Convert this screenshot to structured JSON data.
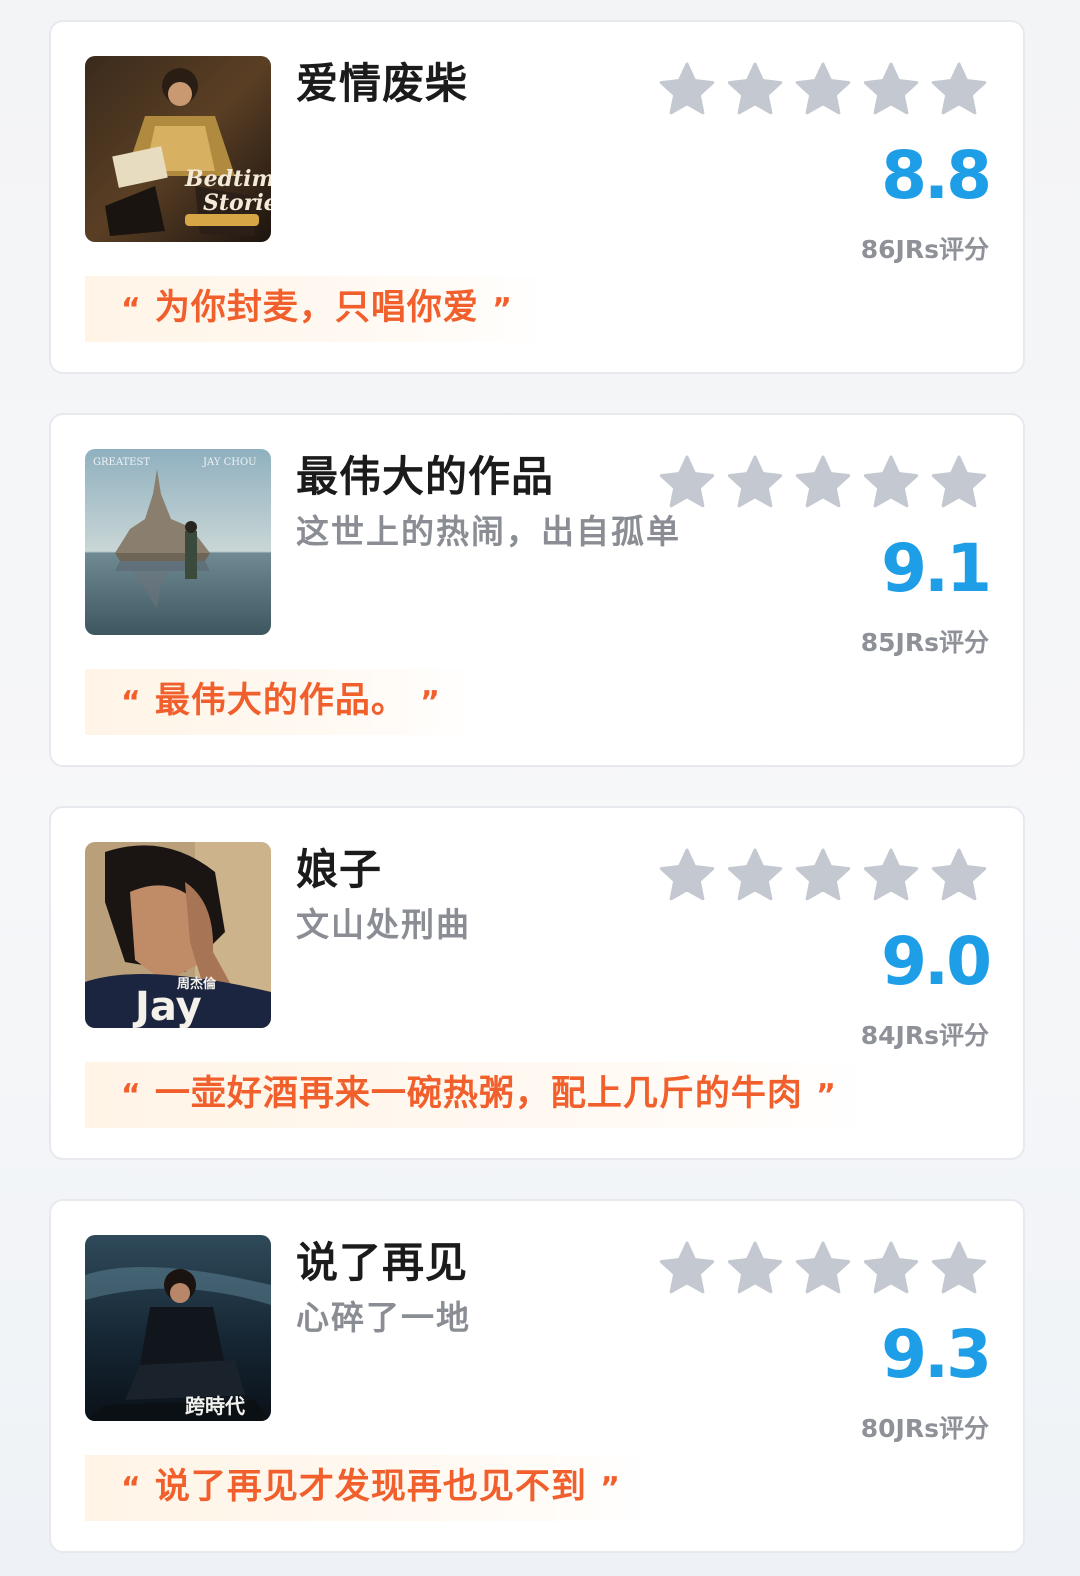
{
  "colors": {
    "score": "#1f9ee8",
    "quote_text": "#f15f2c",
    "quote_bg": "#fff4e6",
    "star": "#c4c8d0",
    "title": "#1b1b1b",
    "subtitle": "#8a8d93"
  },
  "quote_open": "“",
  "quote_close": "”",
  "songs": [
    {
      "title": "爱情废柴",
      "subtitle": "",
      "score": "8.8",
      "votes": "86JRs评分",
      "stars_filled": 0,
      "stars_total": 5,
      "quote": "为你封麦，只唱你爱",
      "cover_icon": "album-cover-bedtime-stories"
    },
    {
      "title": "最伟大的作品",
      "subtitle": "这世上的热闹，出自孤单",
      "score": "9.1",
      "votes": "85JRs评分",
      "stars_filled": 0,
      "stars_total": 5,
      "quote": "最伟大的作品。",
      "cover_icon": "album-cover-greatest-works"
    },
    {
      "title": "娘子",
      "subtitle": "文山处刑曲",
      "score": "9.0",
      "votes": "84JRs评分",
      "stars_filled": 0,
      "stars_total": 5,
      "quote": "一壶好酒再来一碗热粥，配上几斤的牛肉",
      "cover_icon": "album-cover-jay"
    },
    {
      "title": "说了再见",
      "subtitle": "心碎了一地",
      "score": "9.3",
      "votes": "80JRs评分",
      "stars_filled": 0,
      "stars_total": 5,
      "quote": "说了再见才发现再也见不到",
      "cover_icon": "album-cover-the-era"
    }
  ]
}
